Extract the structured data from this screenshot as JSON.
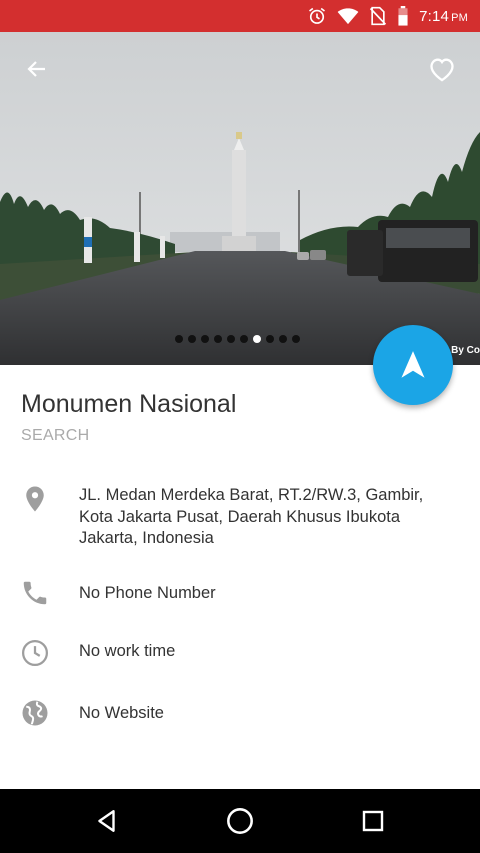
{
  "status_bar": {
    "time": "7:14",
    "ampm": "PM",
    "icons": [
      "alarm-icon",
      "wifi-icon",
      "no-sim-icon",
      "battery-icon"
    ]
  },
  "hero": {
    "watermark": "By Co",
    "pager": {
      "count": 10,
      "active_index": 6
    }
  },
  "place": {
    "name": "Monumen Nasional",
    "category": "SEARCH"
  },
  "details": {
    "address": "JL. Medan Merdeka Barat, RT.2/RW.3, Gambir, Kota Jakarta Pusat, Daerah Khusus Ibukota Jakarta, Indonesia",
    "phone": "No Phone Number",
    "work_time": "No work time",
    "website": "No Website"
  },
  "colors": {
    "status_bar": "#d32f2f",
    "fab": "#1ba5e6",
    "icon_gray": "#9e9e9e"
  }
}
